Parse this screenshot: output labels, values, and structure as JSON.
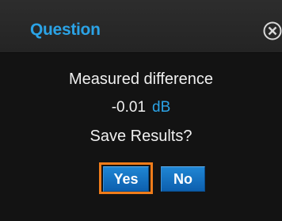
{
  "dialog": {
    "title": "Question",
    "close_icon": "close-icon",
    "message_line1": "Measured difference",
    "value": "-0.01",
    "unit": "dB",
    "message_line3": "Save Results?",
    "yes_label": "Yes",
    "no_label": "No"
  },
  "colors": {
    "accent": "#2ba3e6",
    "focus": "#f07c1a",
    "button": "#1374c4",
    "background": "#141414"
  }
}
